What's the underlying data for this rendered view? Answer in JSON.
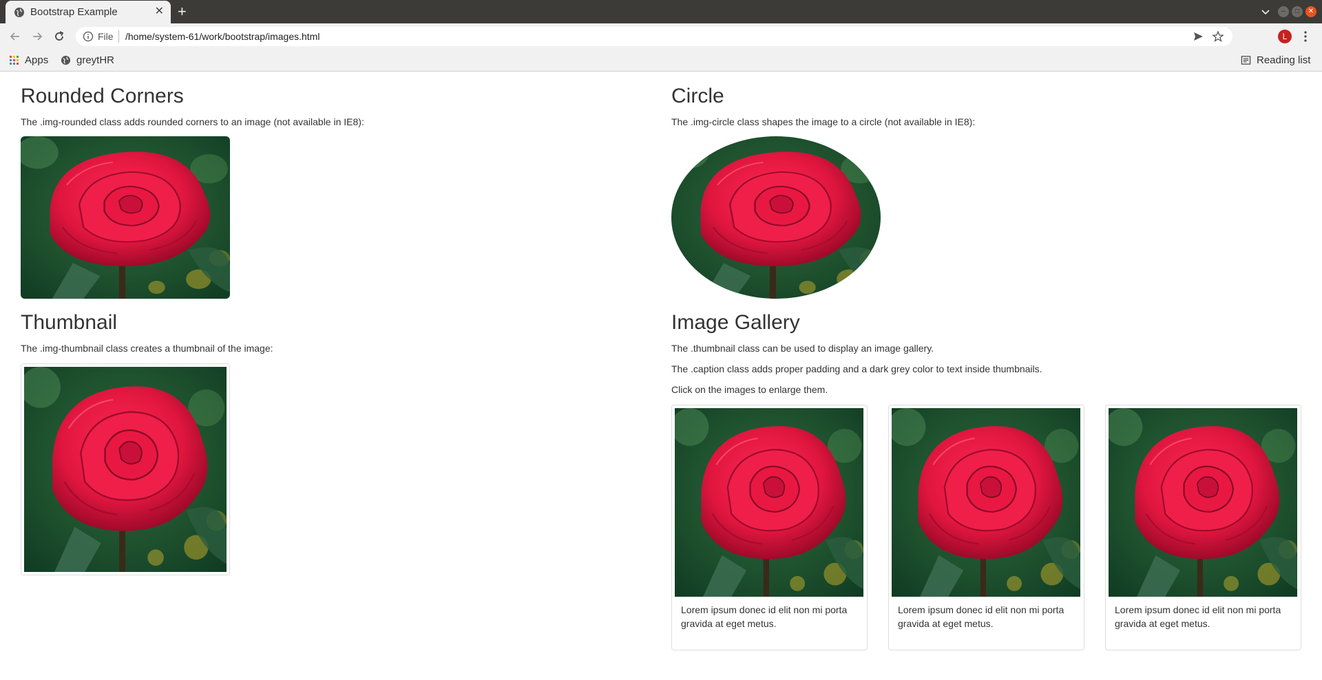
{
  "browser": {
    "tab_title": "Bootstrap Example",
    "new_tab": "+",
    "address_scheme": "File",
    "address_url": "/home/system-61/work/bootstrap/images.html",
    "avatar_letter": "L",
    "bookmarks": [
      {
        "label": "Apps",
        "icon": "apps-grid-icon"
      },
      {
        "label": "greytHR",
        "icon": "globe-icon"
      }
    ],
    "reading_list": "Reading list"
  },
  "page": {
    "rounded": {
      "heading": "Rounded Corners",
      "text": "The .img-rounded class adds rounded corners to an image (not available in IE8):"
    },
    "circle": {
      "heading": "Circle",
      "text": "The .img-circle class shapes the image to a circle (not available in IE8):"
    },
    "thumbnail": {
      "heading": "Thumbnail",
      "text": "The .img-thumbnail class creates a thumbnail of the image:"
    },
    "gallery": {
      "heading": "Image Gallery",
      "lines": [
        "The .thumbnail class can be used to display an image gallery.",
        "The .caption class adds proper padding and a dark grey color to text inside thumbnails.",
        "Click on the images to enlarge them."
      ],
      "items": [
        {
          "caption": "Lorem ipsum donec id elit non mi porta gravida at eget metus."
        },
        {
          "caption": "Lorem ipsum donec id elit non mi porta gravida at eget metus."
        },
        {
          "caption": "Lorem ipsum donec id elit non mi porta gravida at eget metus."
        }
      ]
    }
  },
  "colors": {
    "chrome_dark": "#3c3b37",
    "chrome_light": "#f1f1f1",
    "rose_red": "#e0163f",
    "foliage_green": "#1f5a35",
    "close_orange": "#e95420",
    "avatar_red": "#c5221f"
  }
}
